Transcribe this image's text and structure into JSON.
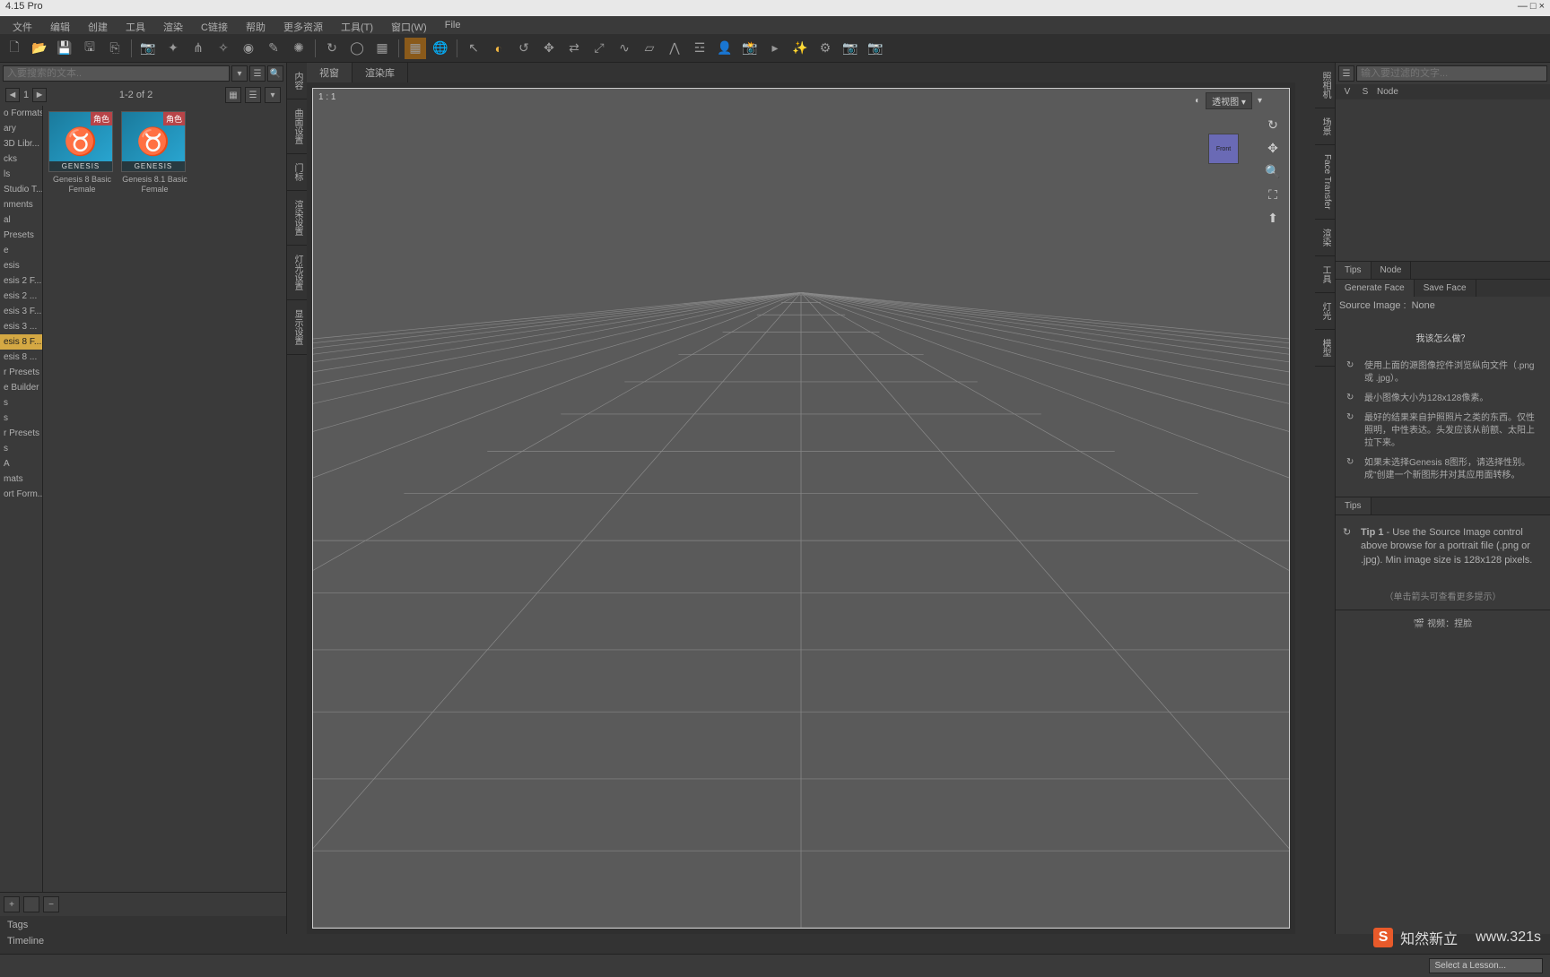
{
  "title": "4.15 Pro",
  "window_controls": "— □ ×",
  "menu": [
    "文件",
    "编辑",
    "创建",
    "工具",
    "渲染",
    "C链接",
    "帮助",
    "更多资源",
    "工具(T)",
    "窗口(W)",
    "File"
  ],
  "toolbar_icons": [
    "file-new",
    "folder-open",
    "save",
    "save-as",
    "import",
    "divider",
    "camera-tool",
    "anim-tool",
    "bone-tool",
    "weight-tool",
    "spotlight-tool",
    "brush-tool",
    "spray-tool",
    "divider",
    "rotate",
    "orbit",
    "frame",
    "divider",
    "grid",
    "globe",
    "divider",
    "cursor",
    "lasso",
    "orbit-cam",
    "move-xyz",
    "translate",
    "scale",
    "morph",
    "polygon",
    "bone-select",
    "mesh",
    "person",
    "cam-photo",
    "play-tool",
    "magic",
    "gear",
    "still-cam",
    "capture"
  ],
  "left": {
    "search_placeholder": "入要搜索的文本..",
    "nav_page": "1",
    "nav_range": "1-2 of 2",
    "tree": [
      "o Formats",
      "ary",
      "3D Libr...",
      "cks",
      "ls",
      "Studio T...",
      "nments",
      "al",
      "Presets",
      "e",
      "esis",
      "esis 2 F...",
      "esis 2 ...",
      "esis 3 F...",
      "esis 3 ...",
      "esis 8 F...",
      "esis 8 ...",
      "r Presets",
      "e Builder",
      "s",
      "s",
      "r Presets",
      "s",
      "A",
      "mats",
      "ort Form..."
    ],
    "tree_selected_index": 15,
    "thumbs": [
      {
        "label": "Genesis 8 Basic Female",
        "badge": "角色",
        "brand": "GENESIS"
      },
      {
        "label": "Genesis 8.1 Basic Female",
        "badge": "角色",
        "brand": "GENESIS"
      }
    ],
    "bottom_tab": "Tags"
  },
  "center": {
    "side_tabs_left": [
      "内容",
      "曲面设置",
      "门标",
      "渲染设置",
      "灯光设置",
      "显示设置"
    ],
    "tabs": [
      "视窗",
      "渲染库"
    ],
    "active_tab": 0,
    "ratio_label": "1 : 1",
    "view_dropdown": "透视图",
    "nav_cube_label": "Front"
  },
  "right": {
    "side_tabs": [
      "照相机",
      "场景",
      "Face Transfer",
      "渲染",
      "工具",
      "灯光",
      "模型"
    ],
    "filter_placeholder": "输入要过滤的文字...",
    "node_headers": [
      "V",
      "S",
      "Node"
    ],
    "tabs_mid": [
      "Tips",
      "Node"
    ],
    "tabs_mid_active": 0,
    "gen_tabs": [
      "Generate Face",
      "Save Face"
    ],
    "gen_tab_active": 0,
    "source_label": "Source Image :",
    "source_value": "None",
    "how_title": "我该怎么做？",
    "bullets": [
      "使用上面的源图像控件浏览纵向文件（.png 或 .jpg）。",
      "最小图像大小为128x128像素。",
      "最好的结果来自护照照片之类的东西。仅性照明，中性表达。头发应该从前额、太阳上拉下来。",
      "如果未选择Genesis 8图形，请选择性别。成\"创建一个新图形并对其应用面转移。"
    ],
    "tips_tab": "Tips",
    "tip_heading": "Tip 1",
    "tip_text": " - Use the Source Image control above browse for a portrait file (.png or .jpg). Min image size is 128x128 pixels.",
    "tip_cycle": "（单击箭头可查看更多提示）",
    "video_action": "视频：捏脸"
  },
  "lesson_placeholder": "Select a Lesson...",
  "timeline_label": "Timeline",
  "watermark": {
    "badge": "S",
    "brand": "知然新立",
    "url": "www.321s"
  }
}
